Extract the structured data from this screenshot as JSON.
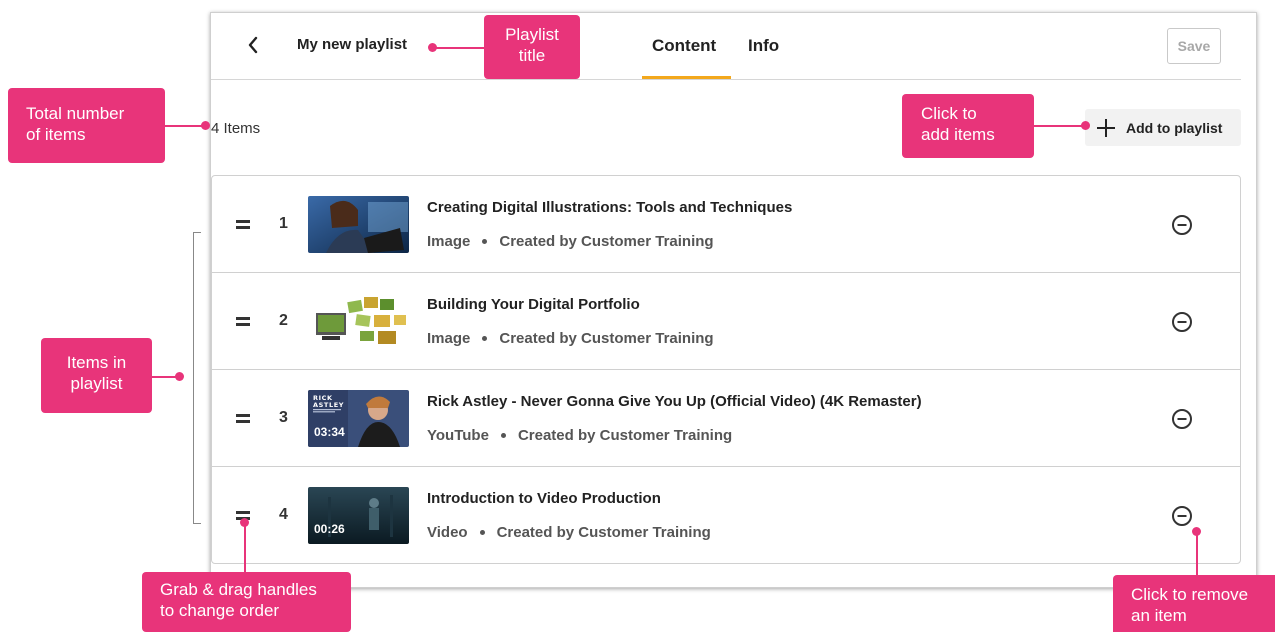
{
  "header": {
    "title": "My new playlist",
    "tabs": [
      "Content",
      "Info"
    ],
    "save_label": "Save"
  },
  "toolbar": {
    "item_count": "4 Items",
    "add_label": "Add to playlist"
  },
  "items": [
    {
      "index": "1",
      "title": "Creating Digital Illustrations: Tools and Techniques",
      "type": "Image",
      "creator": "Created by Customer Training",
      "duration": ""
    },
    {
      "index": "2",
      "title": "Building Your Digital Portfolio",
      "type": "Image",
      "creator": "Created by Customer Training",
      "duration": ""
    },
    {
      "index": "3",
      "title": "Rick Astley - Never Gonna Give You Up (Official Video) (4K Remaster)",
      "type": "YouTube",
      "creator": "Created by Customer Training",
      "duration": "03:34"
    },
    {
      "index": "4",
      "title": "Introduction to Video Production",
      "type": "Video",
      "creator": "Created by Customer Training",
      "duration": "00:26"
    }
  ],
  "annotations": {
    "playlist_title": [
      "Playlist",
      "title"
    ],
    "total_items": [
      "Total number",
      "of items"
    ],
    "add_items": [
      "Click to",
      "add items"
    ],
    "items_in_playlist": [
      "Items in",
      "playlist"
    ],
    "drag_handles": [
      "Grab & drag handles",
      "to change order"
    ],
    "remove_item": [
      "Click to remove",
      "an item"
    ]
  },
  "colors": {
    "accent": "#f3a81c",
    "annotation": "#e8347a"
  },
  "icons": {
    "back": "chevron-left-icon",
    "add": "plus-icon",
    "drag": "drag-handle-icon",
    "remove": "minus-circle-icon"
  }
}
